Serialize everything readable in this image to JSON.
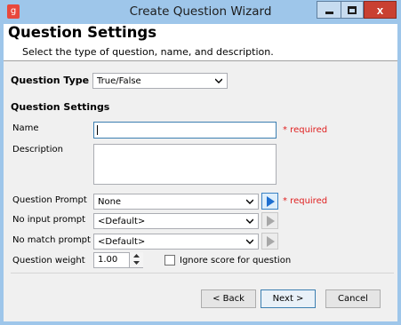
{
  "window": {
    "title": "Create Question Wizard",
    "close_glyph": "x"
  },
  "header": {
    "title": "Question Settings",
    "subtitle": "Select the type of question, name, and description."
  },
  "question_type": {
    "label": "Question Type",
    "selected": "True/False"
  },
  "section_title": "Question Settings",
  "fields": {
    "name_label": "Name",
    "name_value": "",
    "required_text": "* required",
    "description_label": "Description",
    "description_value": "",
    "question_prompt_label": "Question Prompt",
    "question_prompt_value": "None",
    "no_input_label": "No input prompt",
    "no_input_value": "<Default>",
    "no_match_label": "No match prompt",
    "no_match_value": "<Default>",
    "weight_label": "Question weight",
    "weight_value": "1.00",
    "ignore_score_label": "Ignore score for question",
    "ignore_score_checked": false
  },
  "buttons": {
    "back": "< Back",
    "next": "Next >",
    "cancel": "Cancel"
  },
  "icons": {
    "app": "app-logo-icon",
    "play_active_color": "#1e6fd0",
    "play_disabled_color": "#a8a8a8",
    "required_color": "#e02020"
  }
}
